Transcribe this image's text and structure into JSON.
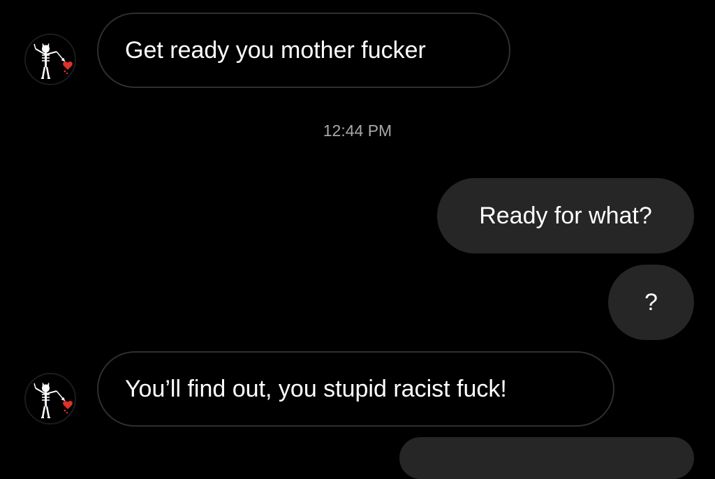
{
  "thread": {
    "messages": [
      {
        "direction": "incoming",
        "text": "Get ready you mother fucker",
        "avatar_icon": "pirate-skeleton-flag-icon"
      },
      {
        "direction": "timestamp",
        "text": "12:44 PM"
      },
      {
        "direction": "outgoing",
        "text": "Ready for what?"
      },
      {
        "direction": "outgoing",
        "text": "?"
      },
      {
        "direction": "incoming",
        "text": "You’ll find out, you stupid racist fuck!",
        "avatar_icon": "pirate-skeleton-flag-icon"
      }
    ]
  },
  "colors": {
    "background": "#000000",
    "incoming_border": "#2f2f2f",
    "outgoing_fill": "#262626",
    "text": "#ffffff",
    "timestamp_text": "#a8a8a8",
    "heart_red": "#e0302b"
  }
}
